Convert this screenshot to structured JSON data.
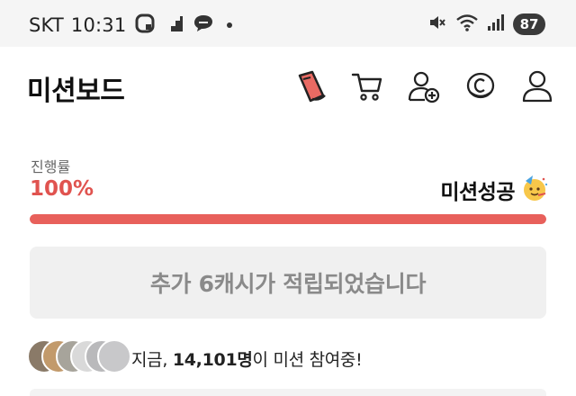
{
  "status_bar": {
    "carrier": "SKT",
    "time": "10:31",
    "battery": "87",
    "left_icons": [
      "notification-app-icon",
      "stairs-icon",
      "chat-bubble-icon"
    ],
    "right_icons": [
      "mute-icon",
      "wifi-icon",
      "signal-icon"
    ]
  },
  "header": {
    "title": "미션보드",
    "icons": [
      "running-shoe-icon",
      "cart-icon",
      "add-friend-icon",
      "coin-icon",
      "profile-icon"
    ]
  },
  "progress": {
    "label": "진행률",
    "percent_text": "100%",
    "value": 1.0,
    "status_text": "미션성공",
    "status_emoji": "party-face-icon",
    "fill_color": "#e8605b",
    "percent_color": "#e0534f"
  },
  "reward": {
    "message": "추가 6캐시가 적립되었습니다"
  },
  "participants": {
    "prefix": "지금, ",
    "count": "14,101명",
    "suffix": "이 미션 참여중!"
  }
}
